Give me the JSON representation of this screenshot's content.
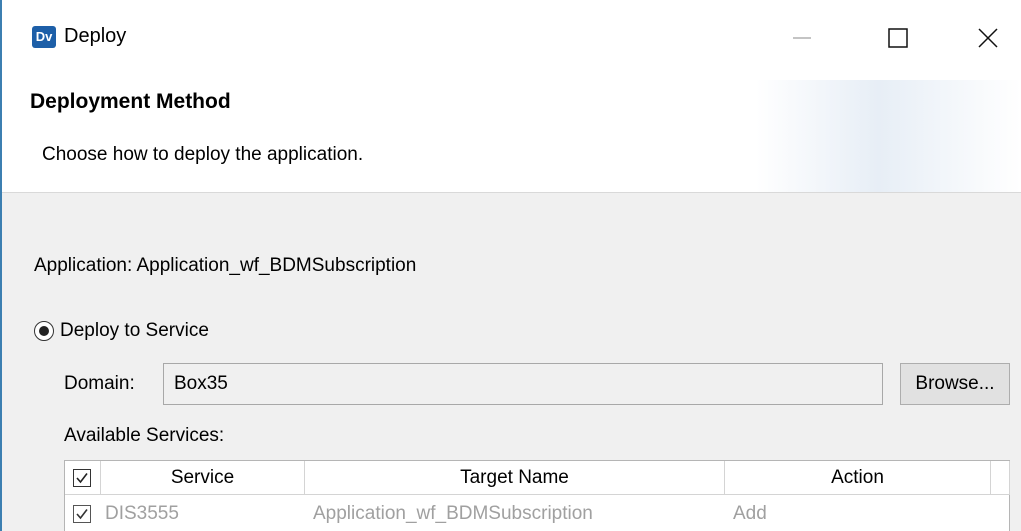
{
  "window": {
    "app_icon_text": "Dv",
    "title": "Deploy"
  },
  "header": {
    "title": "Deployment Method",
    "description": "Choose how to deploy the application."
  },
  "body": {
    "application_label": "Application: Application_wf_BDMSubscription",
    "deploy_option": {
      "label": "Deploy to Service",
      "selected": true
    },
    "domain": {
      "label": "Domain:",
      "value": "Box35",
      "browse_label": "Browse..."
    },
    "available_services_label": "Available Services:"
  },
  "services_table": {
    "columns": [
      "Service",
      "Target Name",
      "Action"
    ],
    "header_checked": true,
    "rows": [
      {
        "checked": true,
        "service": "DIS3555",
        "target_name": "Application_wf_BDMSubscription",
        "action": "Add"
      }
    ]
  }
}
